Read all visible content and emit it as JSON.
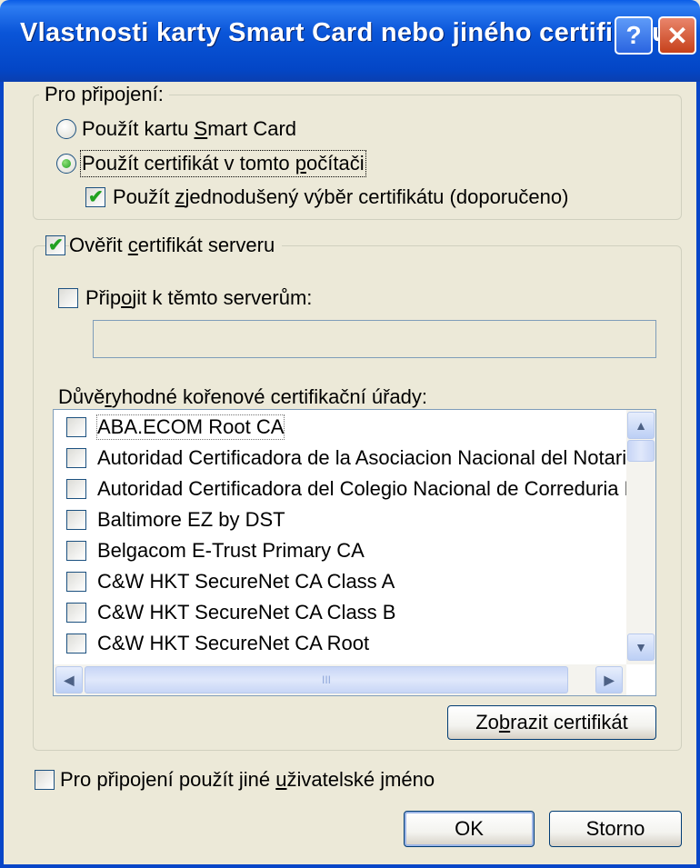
{
  "window": {
    "title": "Vlastnosti karty Smart Card nebo jiného certifikátu",
    "help_glyph": "?",
    "close_glyph": "✕"
  },
  "connect_group": {
    "legend": "Pro připojení:",
    "radio_smartcard": {
      "pre": "Použít kartu ",
      "key": "S",
      "post": "mart Card",
      "selected": false
    },
    "radio_certificate": {
      "pre": "Použít certifikát v tomto ",
      "key": "p",
      "post": "očítači",
      "selected": true
    },
    "simple_selection": {
      "pre": "Použít ",
      "key": "z",
      "post": "jednodušený výběr certifikátu (doporučeno)",
      "checked": true
    }
  },
  "server_group": {
    "verify_cert": {
      "pre": "Ověřit ",
      "key": "c",
      "post": "ertifikát serveru",
      "checked": true
    },
    "connect_servers": {
      "pre": "Přip",
      "key": "o",
      "post": "jit k těmto serverům:",
      "checked": false
    },
    "servers_value": "",
    "trusted_label": {
      "pre": "Důvě",
      "key": "r",
      "post": "yhodné kořenové certifikační úřady:"
    },
    "trusted_cas": [
      "ABA.ECOM Root CA",
      "Autoridad Certificadora de la Asociacion Nacional del Notariado",
      "Autoridad Certificadora del Colegio Nacional de Correduria Publica",
      "Baltimore EZ by DST",
      "Belgacom E-Trust Primary CA",
      "C&W HKT SecureNet CA Class A",
      "C&W HKT SecureNet CA Class B",
      "C&W HKT SecureNet CA Root"
    ],
    "hscroll_grip": "III",
    "view_cert_button": {
      "pre": "Zo",
      "key": "b",
      "post": "razit certifikát"
    }
  },
  "other_username": {
    "pre": "Pro připojení použít jiné ",
    "key": "u",
    "post": "živatelské jméno",
    "checked": false
  },
  "buttons": {
    "ok": "OK",
    "cancel": "Storno"
  },
  "icons": {
    "scroll_up": "▲",
    "scroll_down": "▼",
    "scroll_left": "◀",
    "scroll_right": "▶",
    "check": "✔"
  },
  "colors": {
    "titlebar": "#0a55d8",
    "dialog_bg": "#ece9d8",
    "check_green": "#21a121"
  }
}
